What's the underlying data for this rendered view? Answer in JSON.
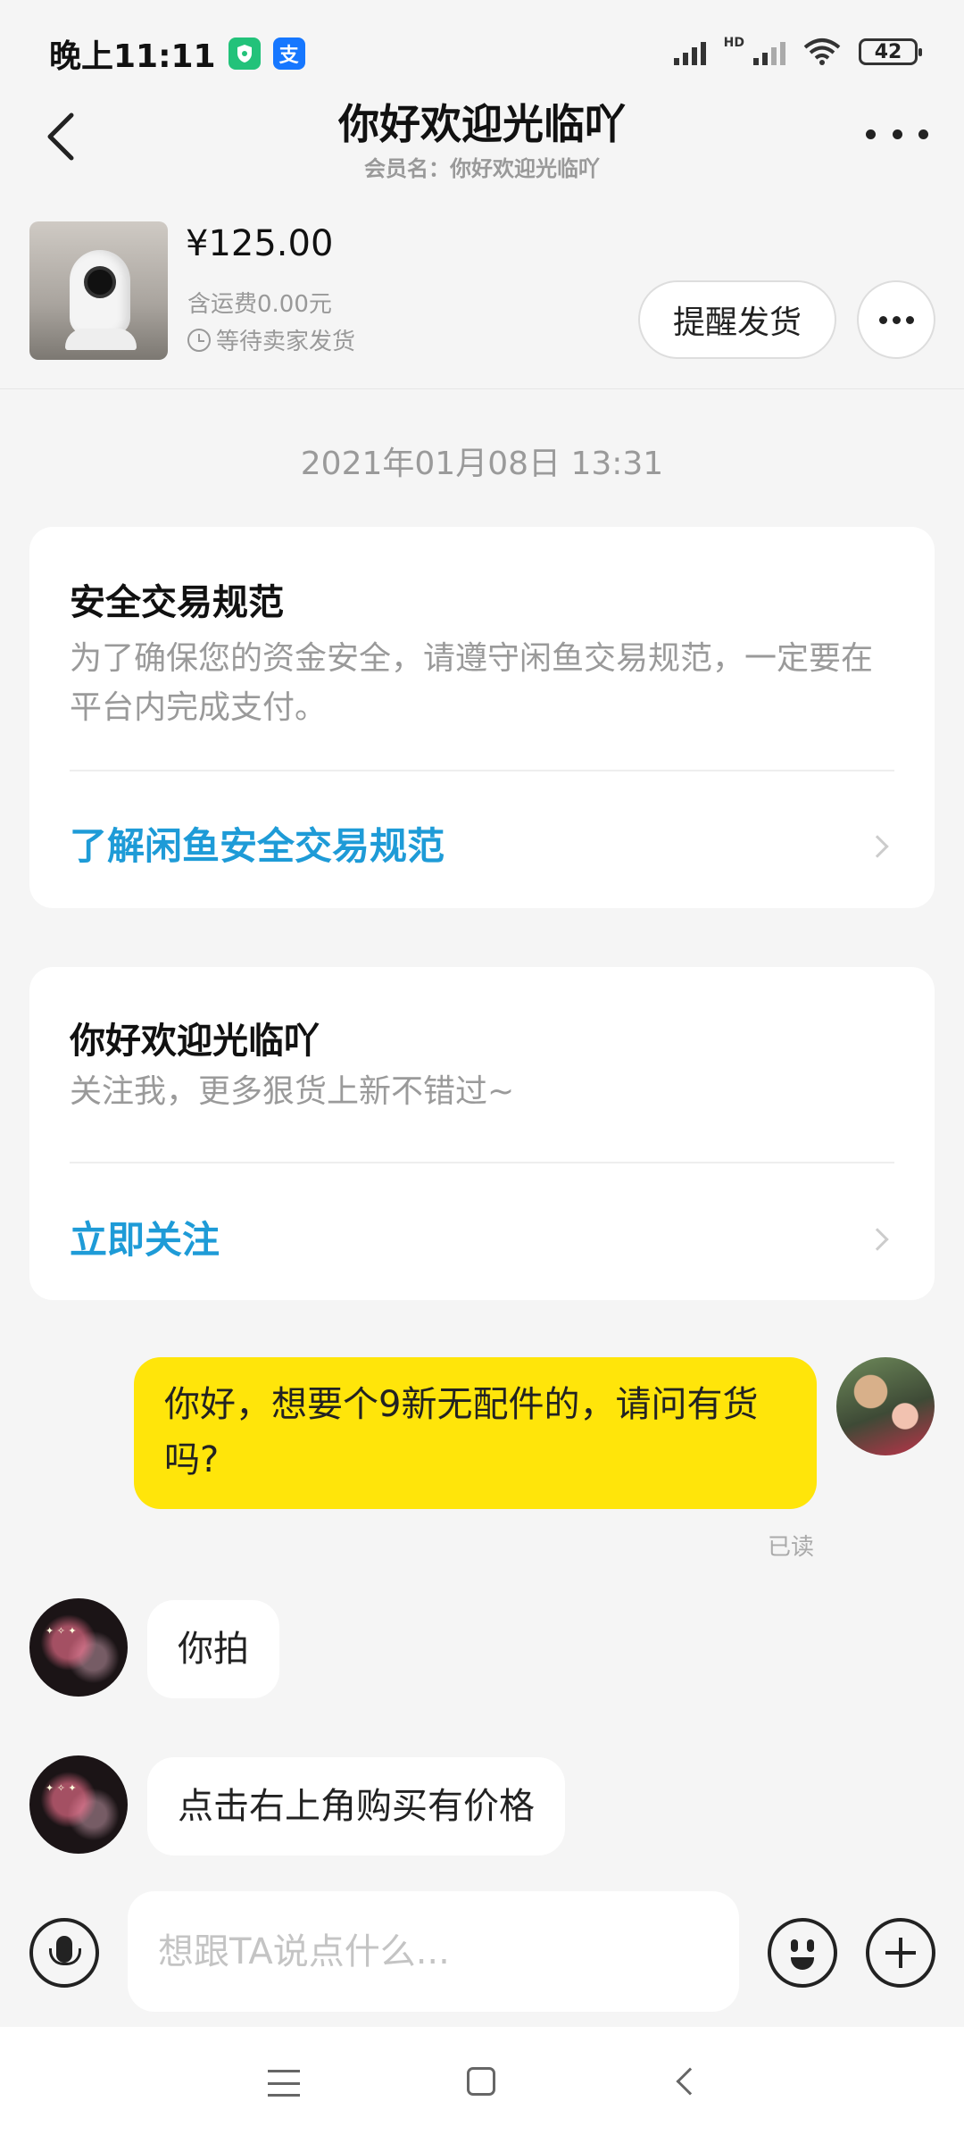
{
  "status_bar": {
    "time": "晚上11:11",
    "network_label": "HD",
    "battery": "42",
    "app_icons": [
      "security-app-icon",
      "alipay-icon"
    ],
    "alipay_glyph": "支"
  },
  "header": {
    "title": "你好欢迎光临吖",
    "subtitle": "会员名：你好欢迎光临吖"
  },
  "product": {
    "price": "¥125.00",
    "shipping": "含运费0.00元",
    "status": "等待卖家发货",
    "remind_button": "提醒发货"
  },
  "timestamp": "2021年01月08日 13:31",
  "cards": [
    {
      "title": "安全交易规范",
      "description": "为了确保您的资金安全，请遵守闲鱼交易规范，一定要在平台内完成支付。",
      "link": "了解闲鱼安全交易规范"
    },
    {
      "title": "你好欢迎光临吖",
      "description": "关注我，更多狠货上新不错过~",
      "link": "立即关注"
    }
  ],
  "messages": [
    {
      "sender": "me",
      "text": "你好，想要个9新无配件的，请问有货吗?",
      "status": "已读"
    },
    {
      "sender": "other",
      "text": "你拍"
    },
    {
      "sender": "other",
      "text": "点击右上角购买有价格"
    }
  ],
  "input": {
    "placeholder": "想跟TA说点什么..."
  },
  "colors": {
    "accent_yellow": "#ffe50a",
    "link_blue": "#1e9bd7",
    "background": "#f5f5f5"
  }
}
